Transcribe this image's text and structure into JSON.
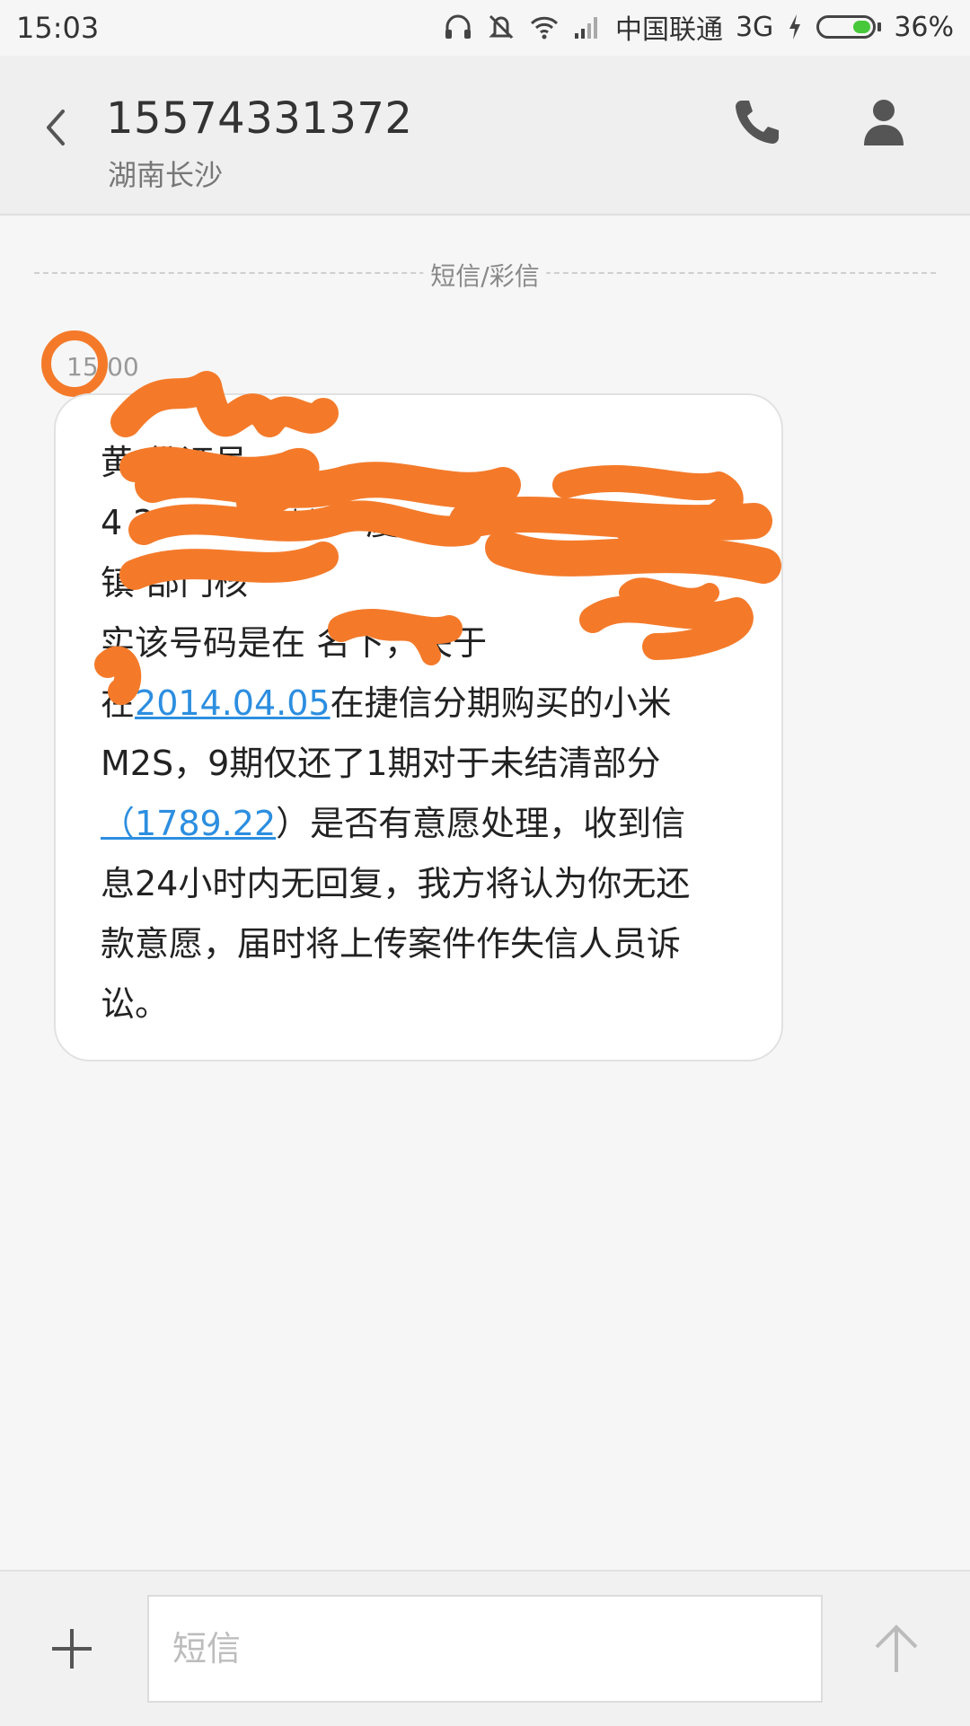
{
  "status_bar": {
    "time": "15:03",
    "carrier": "中国联通",
    "network": "3G",
    "battery_percent": "36%",
    "battery_level": 0.36,
    "icons": [
      "headphones-icon",
      "mute-icon",
      "wifi-icon",
      "signal-icon",
      "charging-icon",
      "battery-icon"
    ]
  },
  "header": {
    "back_icon": "chevron-left-icon",
    "contact_number": "15574331372",
    "contact_location": "湖南长沙",
    "call_icon": "phone-icon",
    "profile_icon": "person-icon"
  },
  "thread": {
    "divider_label": "短信/彩信",
    "message_time": "15:00",
    "message_lines": [
      "黄            份证号",
      "4            221  24****，             厦",
      "镇                        部门核",
      "实该号码是在         名下，关于",
      "在2014.04.05在捷信分期购买的小米",
      "M2S，9期仅还了1期对于未结清部分",
      "（1789.22）是否有意愿处理，收到信",
      "息24小时内无回复，我方将认为你无还",
      "款意愿，届时将上传案件作失信人员诉",
      "讼。"
    ],
    "link_date": "2014.04.05",
    "link_amount": "（1789.22",
    "line5_after": "在捷信分期购买的小米",
    "line7_after": "）是否有意愿处理，收到信",
    "scribble_color": "#f47a2a"
  },
  "composer": {
    "add_icon": "plus-icon",
    "placeholder": "短信",
    "send_icon": "arrow-up-icon"
  },
  "colors": {
    "link": "#2c8ee0",
    "background": "#f6f6f6",
    "header_bg": "#efefef",
    "annotation_orange": "#f47a2a"
  }
}
